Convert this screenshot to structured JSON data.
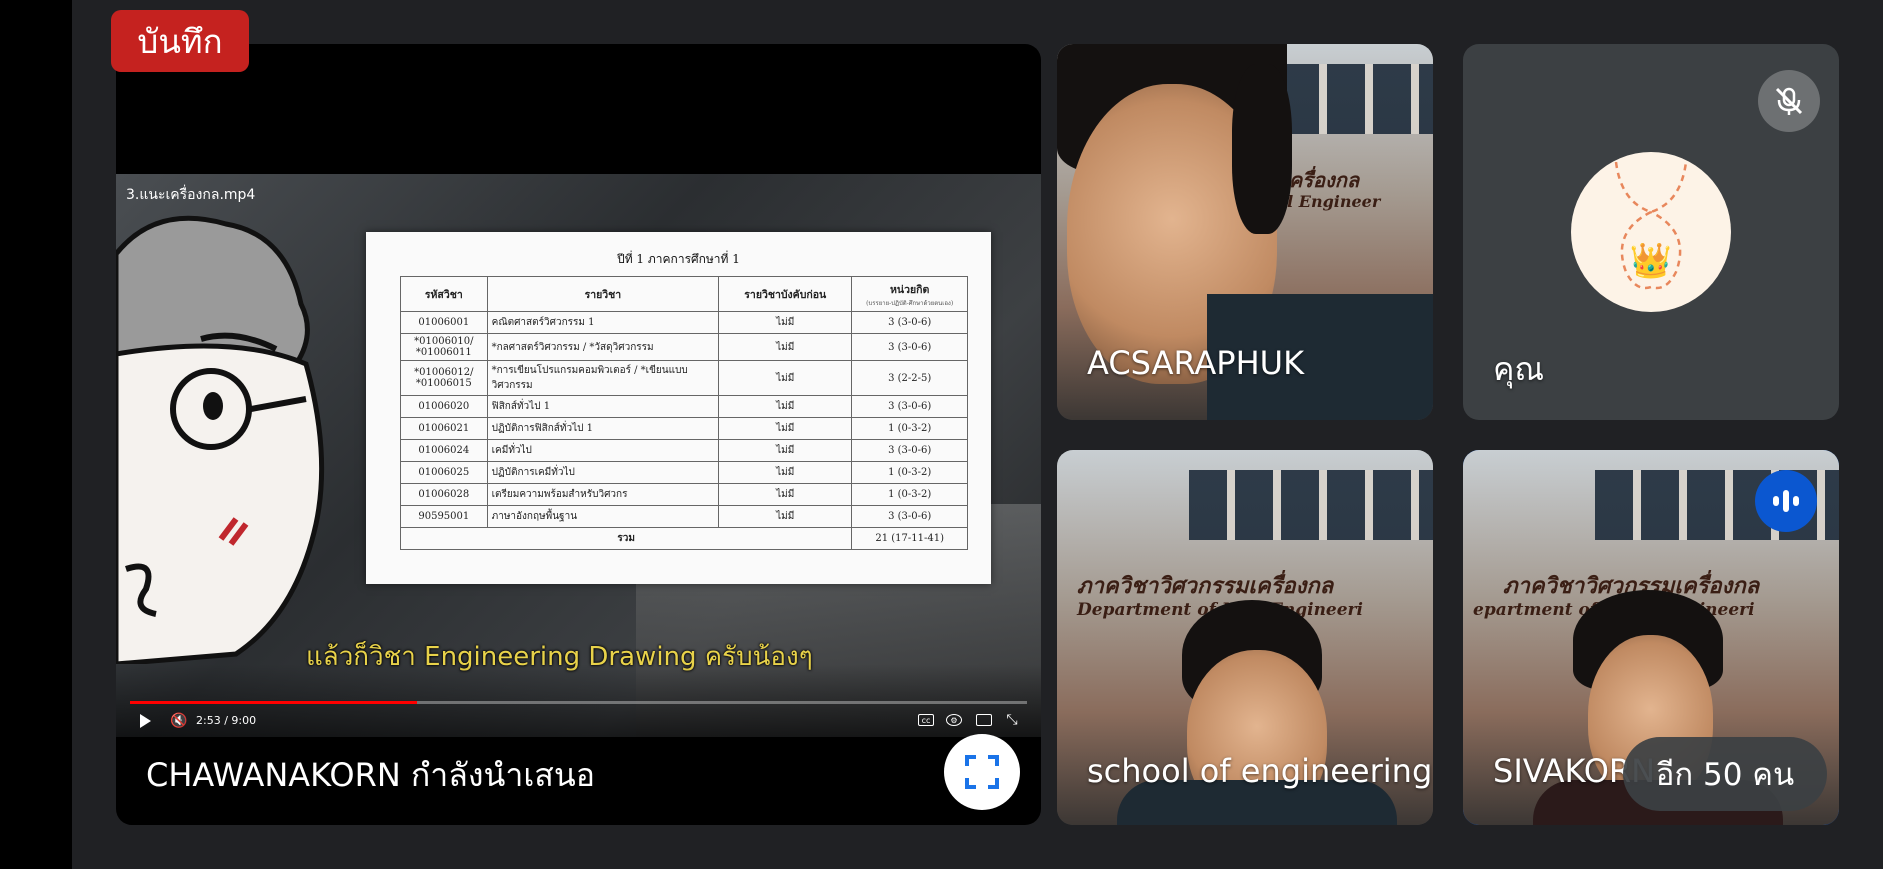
{
  "recording_badge": {
    "label": "บันทึก",
    "color": "#c5221f"
  },
  "presentation": {
    "presenter_label": "CHAWANAKORN กำลังนำเสนอ",
    "fullscreen_icon": "fullscreen-icon",
    "video": {
      "filename": "3.แนะเครื่องกล.mp4",
      "subtitle": "แล้วก็วิชา Engineering Drawing ครับน้องๆ",
      "time": "2:53 / 9:00",
      "progress": 0.32,
      "document": {
        "title": "ปีที่ 1 ภาคการศึกษาที่ 1",
        "headers": [
          "รหัสวิชา",
          "รายวิชา",
          "รายวิชาบังคับก่อน",
          "หน่วยกิต"
        ],
        "credit_subheader": "(บรรยาย-ปฏิบัติ-ศึกษาด้วยตนเอง)",
        "rows": [
          [
            "01006001",
            "คณิตศาสตร์วิศวกรรม 1",
            "ไม่มี",
            "3 (3-0-6)"
          ],
          [
            "*01006010/\n*01006011",
            "*กลศาสตร์วิศวกรรม / *วัสดุวิศวกรรม",
            "ไม่มี",
            "3 (3-0-6)"
          ],
          [
            "*01006012/\n*01006015",
            "*การเขียนโปรแกรมคอมพิวเตอร์ / *เขียนแบบวิศวกรรม",
            "ไม่มี",
            "3 (2-2-5)"
          ],
          [
            "01006020",
            "ฟิสิกส์ทั่วไป 1",
            "ไม่มี",
            "3 (3-0-6)"
          ],
          [
            "01006021",
            "ปฏิบัติการฟิสิกส์ทั่วไป 1",
            "ไม่มี",
            "1 (0-3-2)"
          ],
          [
            "01006024",
            "เคมีทั่วไป",
            "ไม่มี",
            "3 (3-0-6)"
          ],
          [
            "01006025",
            "ปฏิบัติการเคมีทั่วไป",
            "ไม่มี",
            "1 (0-3-2)"
          ],
          [
            "01006028",
            "เตรียมความพร้อมสำหรับวิศวกร",
            "ไม่มี",
            "1 (0-3-2)"
          ],
          [
            "90595001",
            "ภาษาอังกฤษพื้นฐาน",
            "ไม่มี",
            "3 (3-0-6)"
          ]
        ],
        "total_label": "รวม",
        "total_value": "21 (17-11-41)"
      }
    }
  },
  "participants": {
    "acsaraphuk": {
      "name": "ACSARAPHUK",
      "sign_text": "เครื่องกล",
      "sign_text2": "cal Engineer"
    },
    "you": {
      "name": "คุณ",
      "mic_state": "muted",
      "avatar": "crown-avatar"
    },
    "school": {
      "name": "school of engineering",
      "sign_text": "ภาควิชาวิศวกรรมเครื่องกล",
      "sign_text2": "Department of M   al Engineeri"
    },
    "sivakorn": {
      "name": "SIVAKORN",
      "sign_text": "ภาควิชาวิศวกรรมเครื่องกล",
      "sign_text2": "epartment of M   cal Engineeri",
      "speaking": true,
      "highlight_color": "#0b57d0"
    }
  },
  "more_participants": {
    "label": "อีก 50 คน"
  }
}
